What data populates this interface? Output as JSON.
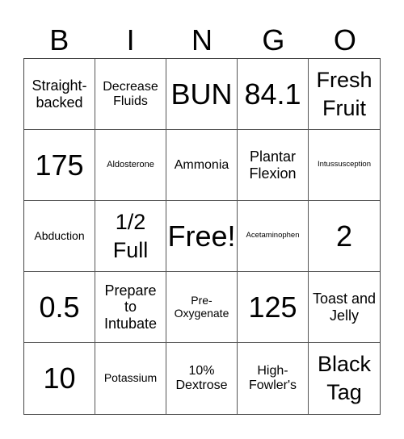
{
  "header": [
    "B",
    "I",
    "N",
    "G",
    "O"
  ],
  "cells": [
    {
      "text": "Straight-backed",
      "size": "md"
    },
    {
      "text": "Decrease Fluids",
      "size": "sm"
    },
    {
      "text": "BUN",
      "size": "xl"
    },
    {
      "text": "84.1",
      "size": "xl"
    },
    {
      "text": "Fresh Fruit",
      "size": "lg"
    },
    {
      "text": "175",
      "size": "xl"
    },
    {
      "text": "Aldosterone",
      "size": "xxs"
    },
    {
      "text": "Ammonia",
      "size": "sm"
    },
    {
      "text": "Plantar Flexion",
      "size": "md"
    },
    {
      "text": "Intussusception",
      "size": "tiny"
    },
    {
      "text": "Abduction",
      "size": "xs"
    },
    {
      "text": "1/2 Full",
      "size": "lg"
    },
    {
      "text": "Free!",
      "size": "xl"
    },
    {
      "text": "Acetaminophen",
      "size": "tiny"
    },
    {
      "text": "2",
      "size": "xl"
    },
    {
      "text": "0.5",
      "size": "xl"
    },
    {
      "text": "Prepare to Intubate",
      "size": "md"
    },
    {
      "text": "Pre-Oxygenate",
      "size": "xs"
    },
    {
      "text": "125",
      "size": "xl"
    },
    {
      "text": "Toast and Jelly",
      "size": "md"
    },
    {
      "text": "10",
      "size": "xl"
    },
    {
      "text": "Potassium",
      "size": "xs"
    },
    {
      "text": "10% Dextrose",
      "size": "sm"
    },
    {
      "text": "High-Fowler's",
      "size": "sm"
    },
    {
      "text": "Black Tag",
      "size": "lg"
    }
  ]
}
